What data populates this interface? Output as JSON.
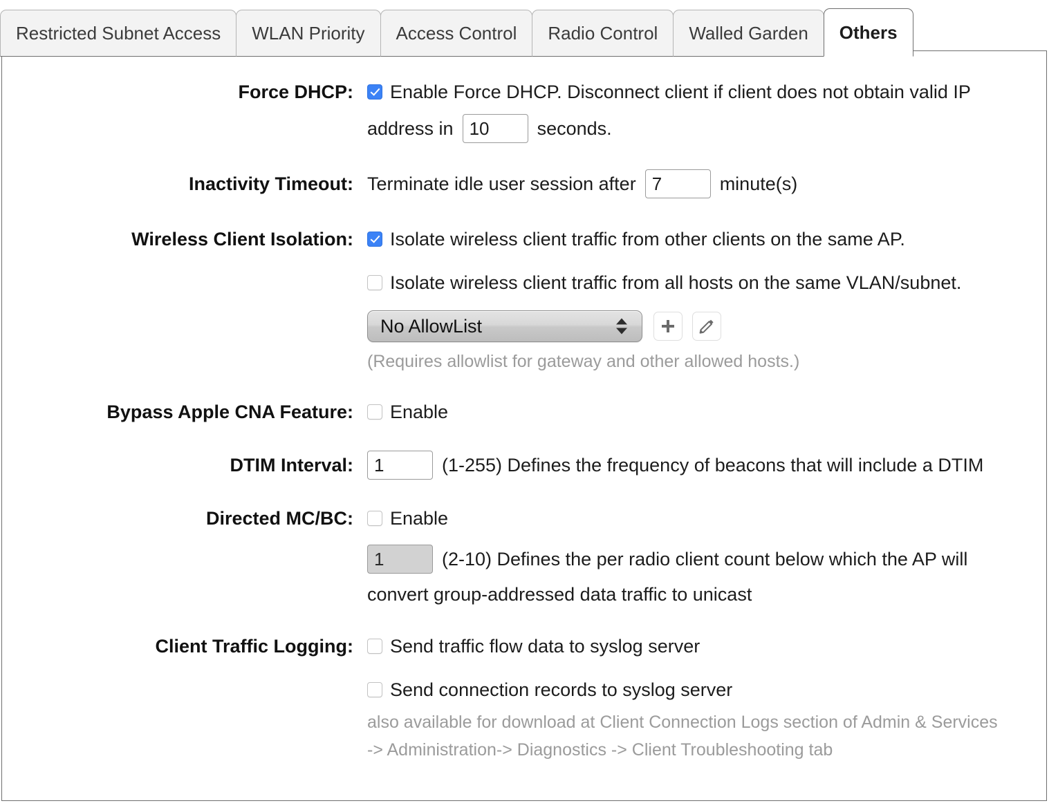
{
  "tabs": [
    {
      "label": "Restricted Subnet Access",
      "active": false
    },
    {
      "label": "WLAN Priority",
      "active": false
    },
    {
      "label": "Access Control",
      "active": false
    },
    {
      "label": "Radio Control",
      "active": false
    },
    {
      "label": "Walled Garden",
      "active": false
    },
    {
      "label": "Others",
      "active": true
    }
  ],
  "colors": {
    "checkbox_checked": "#3b82f6",
    "panel_border": "#6e6e6e",
    "tab_inactive_bg": "#f3f3f3",
    "hint_text": "#9b9b9b"
  },
  "form": {
    "force_dhcp": {
      "label": "Force DHCP:",
      "enable_checked": true,
      "enable_text": "Enable Force DHCP. Disconnect client if client does not obtain valid IP",
      "second_line_prefix": "address in",
      "timeout_value": "10",
      "second_line_suffix": "seconds."
    },
    "inactivity_timeout": {
      "label": "Inactivity Timeout:",
      "prefix": "Terminate idle user session after",
      "value": "7",
      "suffix": "minute(s)"
    },
    "wireless_client_isolation": {
      "label": "Wireless Client Isolation:",
      "option1_checked": true,
      "option1_text": "Isolate wireless client traffic from other clients on the same AP.",
      "option2_checked": false,
      "option2_text": "Isolate wireless client traffic from all hosts on the same VLAN/subnet.",
      "allowlist_selected": "No AllowList",
      "allowlist_options": [
        "No AllowList"
      ],
      "add_button_icon": "plus-icon",
      "edit_button_icon": "pencil-icon",
      "hint": "(Requires allowlist for gateway and other allowed hosts.)"
    },
    "bypass_apple_cna": {
      "label": "Bypass Apple CNA Feature:",
      "enable_checked": false,
      "enable_text": "Enable"
    },
    "dtim_interval": {
      "label": "DTIM Interval:",
      "value": "1",
      "description": "(1-255) Defines the frequency of beacons that will include a DTIM"
    },
    "directed_mc_bc": {
      "label": "Directed MC/BC:",
      "enable_checked": false,
      "enable_text": "Enable",
      "count_value": "1",
      "count_disabled": true,
      "description_line1": "(2-10) Defines the per radio client count below which the AP will",
      "description_line2": "convert group-addressed data traffic to unicast"
    },
    "client_traffic_logging": {
      "label": "Client Traffic Logging:",
      "option1_checked": false,
      "option1_text": "Send traffic flow data to syslog server",
      "option2_checked": false,
      "option2_text": "Send connection records to syslog server",
      "note_line1": "also available for download at Client Connection Logs section of Admin & Services",
      "note_line2": "-> Administration-> Diagnostics -> Client Troubleshooting tab"
    }
  }
}
